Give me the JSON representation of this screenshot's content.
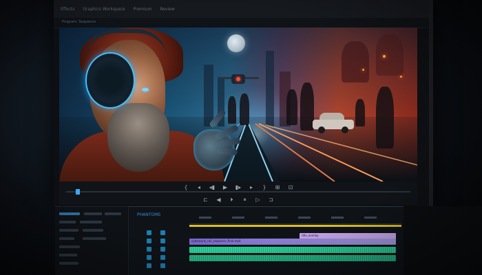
{
  "app": {
    "menu": [
      "Effects",
      "Graphics Workspace",
      "Premium",
      "Review"
    ]
  },
  "header_tab": "Program: Sequence",
  "viewer": {
    "timecode_left": "00:00:00",
    "timecode_right": "00:00:00"
  },
  "transport": {
    "row1": [
      "{",
      "◂",
      "◂▮",
      "▶",
      "▮▸",
      "▸",
      "}",
      "⊞",
      "⊡"
    ],
    "row2": [
      "⊏",
      "◀",
      "⏵",
      "⏸",
      "▷",
      "⊐"
    ]
  },
  "timeline": {
    "title": "PHANTOMS",
    "ruler_labels": [
      "00:00",
      "00:15",
      "00:30",
      "00:45",
      "01:00",
      "01:15"
    ],
    "video_clip_label": "cyberpunk_rail_sequence_final.mp4",
    "purple_clip_label": "title_overlay"
  },
  "colors": {
    "accent": "#2aa8ff",
    "playbar": "#e0c21a",
    "audio_clip": "#2fd9a0",
    "video_clip": "#a49be0"
  }
}
